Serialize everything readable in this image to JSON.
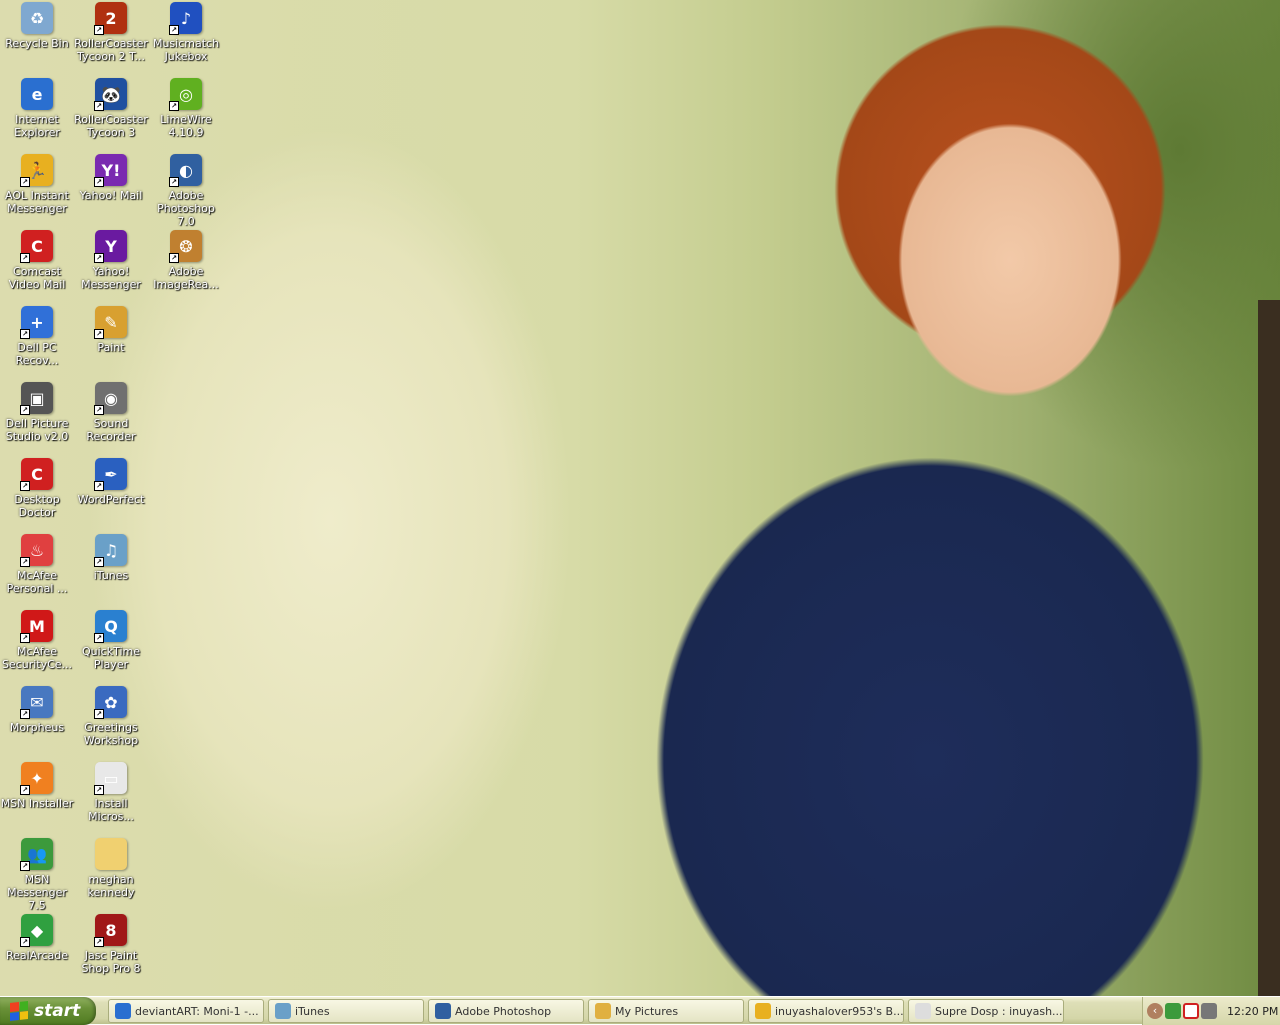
{
  "desktop_icons": [
    {
      "col": 0,
      "row": 0,
      "label": "Recycle Bin",
      "color": "#7fa8d0",
      "glyph": "♻",
      "shortcut": false
    },
    {
      "col": 0,
      "row": 1,
      "label": "Internet Explorer",
      "color": "#2a6fd0",
      "glyph": "e",
      "shortcut": false
    },
    {
      "col": 0,
      "row": 2,
      "label": "AOL Instant Messenger",
      "color": "#e8b020",
      "glyph": "🏃",
      "shortcut": true
    },
    {
      "col": 0,
      "row": 3,
      "label": "Comcast Video Mail",
      "color": "#d02020",
      "glyph": "C",
      "shortcut": true
    },
    {
      "col": 0,
      "row": 4,
      "label": "Dell PC Recov...",
      "color": "#3070d8",
      "glyph": "+",
      "shortcut": true
    },
    {
      "col": 0,
      "row": 5,
      "label": "Dell Picture Studio v2.0",
      "color": "#555",
      "glyph": "▣",
      "shortcut": true
    },
    {
      "col": 0,
      "row": 6,
      "label": "Desktop Doctor",
      "color": "#d02020",
      "glyph": "C",
      "shortcut": true
    },
    {
      "col": 0,
      "row": 7,
      "label": "McAfee Personal ...",
      "color": "#e04040",
      "glyph": "♨",
      "shortcut": true
    },
    {
      "col": 0,
      "row": 8,
      "label": "McAfee SecurityCe...",
      "color": "#d01818",
      "glyph": "M",
      "shortcut": true
    },
    {
      "col": 0,
      "row": 9,
      "label": "Morpheus",
      "color": "#4878c0",
      "glyph": "✉",
      "shortcut": true
    },
    {
      "col": 0,
      "row": 10,
      "label": "MSN Installer",
      "color": "#f08020",
      "glyph": "✦",
      "shortcut": true
    },
    {
      "col": 0,
      "row": 11,
      "label": "MSN Messenger 7.5",
      "color": "#3c9a3c",
      "glyph": "👥",
      "shortcut": true
    },
    {
      "col": 0,
      "row": 12,
      "label": "RealArcade",
      "color": "#30a040",
      "glyph": "◆",
      "shortcut": true
    },
    {
      "col": 1,
      "row": 0,
      "label": "RollerCoaster Tycoon 2 T...",
      "color": "#b03010",
      "glyph": "2",
      "shortcut": true
    },
    {
      "col": 1,
      "row": 1,
      "label": "RollerCoaster Tycoon 3",
      "color": "#2050a0",
      "glyph": "🐼",
      "shortcut": true
    },
    {
      "col": 1,
      "row": 2,
      "label": "Yahoo! Mail",
      "color": "#7a2ab0",
      "glyph": "Y!",
      "shortcut": true
    },
    {
      "col": 1,
      "row": 3,
      "label": "Yahoo! Messenger",
      "color": "#6a1aa0",
      "glyph": "Y",
      "shortcut": true
    },
    {
      "col": 1,
      "row": 4,
      "label": "Paint",
      "color": "#d8a030",
      "glyph": "✎",
      "shortcut": true
    },
    {
      "col": 1,
      "row": 5,
      "label": "Sound Recorder",
      "color": "#707070",
      "glyph": "◉",
      "shortcut": true
    },
    {
      "col": 1,
      "row": 6,
      "label": "WordPerfect",
      "color": "#2a60c0",
      "glyph": "✒",
      "shortcut": true
    },
    {
      "col": 1,
      "row": 7,
      "label": "iTunes",
      "color": "#6aa0c8",
      "glyph": "♫",
      "shortcut": true
    },
    {
      "col": 1,
      "row": 8,
      "label": "QuickTime Player",
      "color": "#2a80d0",
      "glyph": "Q",
      "shortcut": true
    },
    {
      "col": 1,
      "row": 9,
      "label": "Greetings Workshop",
      "color": "#3a6ac0",
      "glyph": "✿",
      "shortcut": true
    },
    {
      "col": 1,
      "row": 10,
      "label": "Install Micros...",
      "color": "#e8e8e8",
      "glyph": "▭",
      "shortcut": true
    },
    {
      "col": 1,
      "row": 11,
      "label": "meghan kennedy",
      "color": "#f0d070",
      "glyph": "",
      "shortcut": false
    },
    {
      "col": 1,
      "row": 12,
      "label": "Jasc Paint Shop Pro 8",
      "color": "#a01818",
      "glyph": "8",
      "shortcut": true
    },
    {
      "col": 2,
      "row": 0,
      "label": "Musicmatch Jukebox",
      "color": "#2050c0",
      "glyph": "♪",
      "shortcut": true
    },
    {
      "col": 2,
      "row": 1,
      "label": "LimeWire 4.10.9",
      "color": "#60b020",
      "glyph": "◎",
      "shortcut": true
    },
    {
      "col": 2,
      "row": 2,
      "label": "Adobe Photoshop 7.0",
      "color": "#3060a0",
      "glyph": "◐",
      "shortcut": true
    },
    {
      "col": 2,
      "row": 3,
      "label": "Adobe ImageRea...",
      "color": "#c08030",
      "glyph": "❂",
      "shortcut": true
    }
  ],
  "taskbar": {
    "start_label": "start",
    "tasks": [
      {
        "label": "deviantART: Moni-1 -...",
        "color": "#2a6fd0"
      },
      {
        "label": "iTunes",
        "color": "#6aa0c8"
      },
      {
        "label": "Adobe Photoshop",
        "color": "#3060a0"
      },
      {
        "label": "My Pictures",
        "color": "#e0b040"
      },
      {
        "label": "inuyashalover953's B...",
        "color": "#e8b020"
      },
      {
        "label": "Supre Dosp : inuyash...",
        "color": "#dddddd"
      }
    ],
    "clock": "12:20 PM"
  }
}
